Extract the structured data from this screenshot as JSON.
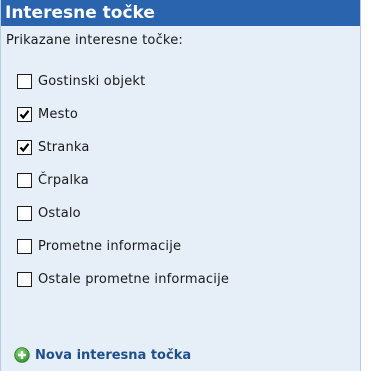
{
  "panel": {
    "title": "Interesne točke",
    "subtitle": "Prikazane interesne točke:"
  },
  "options": [
    {
      "label": "Gostinski objekt",
      "checked": false
    },
    {
      "label": "Mesto",
      "checked": true
    },
    {
      "label": "Stranka",
      "checked": true
    },
    {
      "label": "Črpalka",
      "checked": false
    },
    {
      "label": "Ostalo",
      "checked": false
    },
    {
      "label": "Prometne informacije",
      "checked": false
    },
    {
      "label": "Ostale prometne informacije",
      "checked": false
    }
  ],
  "new_point": {
    "label": "Nova interesna točka",
    "icon": "add-circle-icon"
  },
  "colors": {
    "header_bg": "#2a63ae",
    "panel_bg": "#e6eef8",
    "link": "#1e4f8a",
    "add_icon": "#3aa33a"
  }
}
